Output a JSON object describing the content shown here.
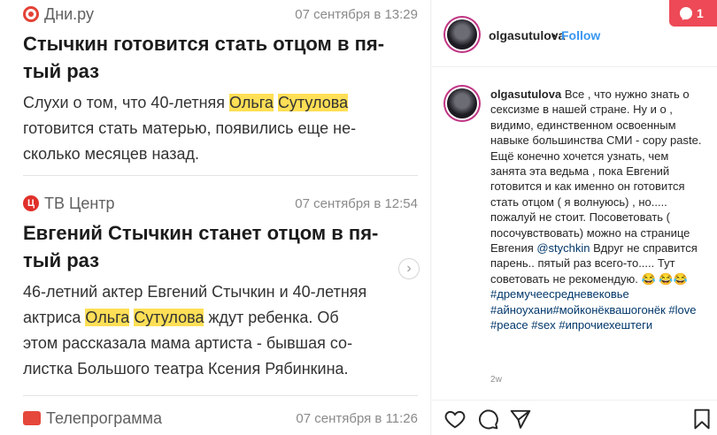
{
  "news": [
    {
      "source": "Дни.ру",
      "date": "07 сентября в 13:29",
      "headline_lines": [
        "Стычкин готовится стать отцом в пя-",
        "тый раз"
      ],
      "snippet_lines": [
        {
          "pre": "Слухи о том, что 40-летняя ",
          "hl1": "Ольга",
          "hl2": "Сутулова",
          "post": ""
        },
        {
          "text": "готовится стать матерью, появились еще не-"
        },
        {
          "text": "сколько месяцев назад."
        }
      ]
    },
    {
      "source": "ТВ Центр",
      "logo_letter": "Ц",
      "date": "07 сентября в 12:54",
      "headline_lines": [
        "Евгений Стычкин станет отцом в пя-",
        "тый раз"
      ],
      "snippet_lines": [
        {
          "text": "46-летний актер Евгений Стычкин и 40-летняя"
        },
        {
          "pre": "актриса ",
          "hl1": "Ольга",
          "hl2": "Сутулова",
          "post": " ждут ребенка. Об"
        },
        {
          "text": "этом рассказала мама артиста - бывшая со-"
        },
        {
          "text": "листка Большого театра Ксения Рябинкина."
        }
      ]
    },
    {
      "source": "Телепрограмма",
      "date": "07 сентября в 11:26"
    }
  ],
  "notification_count": "1",
  "header": {
    "username": "olgasutulova",
    "dot": "•",
    "follow": "Follow"
  },
  "caption": {
    "username": "olgasutulova",
    "text_part1": "Все , что нужно знать о сексизме в нашей стране. Ну и о , видимо, единственном освоенным навыке большинства СМИ - copy paste. Ещё конечно хочется узнать, чем занята эта ведьма , пока Евгений готовится и как именно он готовится стать отцом ( я волнуюсь) , но..... пожалуй не стоит. Посоветовать ( посочувствовать) можно на странице Евгения ",
    "mention": "@stychkin",
    "text_part2": " Вдруг не справится парень.. пятый раз всего-то..... Тут советовать не рекомендую. 😂",
    "emoji_pre": "😂😂",
    "tags": [
      "#дремучеесредневековье",
      "#айноухани",
      "#мойконёквашогонёк",
      "#love",
      "#peace",
      "#sex",
      "#ипрочиехештеги"
    ]
  },
  "time_ago": "2w",
  "icons": [
    "heart-icon",
    "comment-icon",
    "share-icon",
    "bookmark-icon",
    "bubble-icon",
    "chevron-right-icon"
  ],
  "colors": {
    "follow": "#3897f0",
    "highlight": "#ffdf56",
    "notification": "#ed4956",
    "hashtag": "#00376b"
  }
}
